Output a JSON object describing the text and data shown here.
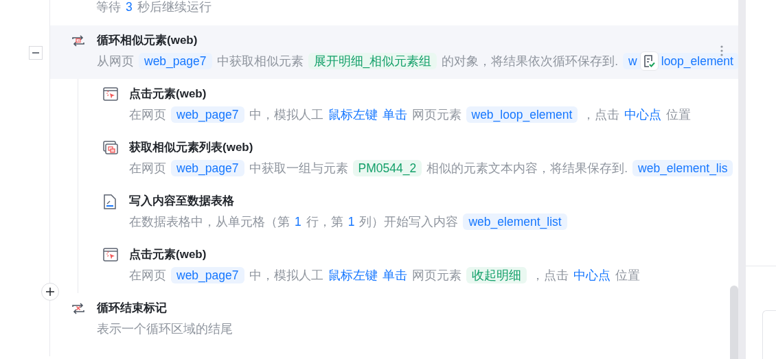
{
  "steps": [
    {
      "kind": "partial",
      "description": [
        {
          "kind": "text",
          "text": "等待"
        },
        {
          "kind": "param",
          "text": "3"
        },
        {
          "kind": "text",
          "text": "秒后继续运行"
        }
      ]
    },
    {
      "kind": "loop",
      "selected": true,
      "expanded": true,
      "title": "循环相似元素(web)",
      "description": [
        {
          "kind": "text",
          "text": "从网页"
        },
        {
          "kind": "var",
          "text": "web_page7"
        },
        {
          "kind": "text",
          "text": "中获取相似元素"
        },
        {
          "kind": "elem",
          "text": "展开明细_相似元素组"
        },
        {
          "kind": "text",
          "text": "的对象，将结果依次循环保存到."
        },
        {
          "kind": "var-split",
          "parts": [
            "w",
            "loop_element"
          ]
        }
      ],
      "children": [
        {
          "kind": "click",
          "selected": false,
          "title": "点击元素(web)",
          "description": [
            {
              "kind": "text",
              "text": "在网页"
            },
            {
              "kind": "var",
              "text": "web_page7"
            },
            {
              "kind": "text",
              "text": "中，模拟人工"
            },
            {
              "kind": "param",
              "text": "鼠标左键"
            },
            {
              "kind": "param",
              "text": "单击"
            },
            {
              "kind": "text",
              "text": "网页元素"
            },
            {
              "kind": "var",
              "text": "web_loop_element"
            },
            {
              "kind": "text",
              "text": "，点击"
            },
            {
              "kind": "param",
              "text": "中心点"
            },
            {
              "kind": "text",
              "text": "位置"
            }
          ]
        },
        {
          "kind": "list",
          "selected": false,
          "title": "获取相似元素列表(web)",
          "description": [
            {
              "kind": "text",
              "text": "在网页"
            },
            {
              "kind": "var",
              "text": "web_page7"
            },
            {
              "kind": "text",
              "text": "中获取一组与元素"
            },
            {
              "kind": "elem",
              "text": "PM0544_2"
            },
            {
              "kind": "text",
              "text": "相似的元素文本内容，将结果保存到."
            },
            {
              "kind": "var",
              "text": "web_element_lis"
            }
          ]
        },
        {
          "kind": "write",
          "selected": false,
          "title": "写入内容至数据表格",
          "description": [
            {
              "kind": "text",
              "text": "在数据表格中，从单元格（第"
            },
            {
              "kind": "param",
              "text": "1"
            },
            {
              "kind": "text",
              "text": "行，第"
            },
            {
              "kind": "param",
              "text": "1"
            },
            {
              "kind": "text",
              "text": "列）开始写入内容"
            },
            {
              "kind": "var",
              "text": "web_element_list"
            }
          ]
        },
        {
          "kind": "click",
          "selected": false,
          "title": "点击元素(web)",
          "description": [
            {
              "kind": "text",
              "text": "在网页"
            },
            {
              "kind": "var",
              "text": "web_page7"
            },
            {
              "kind": "text",
              "text": "中，模拟人工"
            },
            {
              "kind": "param",
              "text": "鼠标左键"
            },
            {
              "kind": "param",
              "text": "单击"
            },
            {
              "kind": "text",
              "text": "网页元素"
            },
            {
              "kind": "elem",
              "text": "收起明细"
            },
            {
              "kind": "text",
              "text": "，点击"
            },
            {
              "kind": "param",
              "text": "中心点"
            },
            {
              "kind": "text",
              "text": "位置"
            }
          ]
        }
      ]
    },
    {
      "kind": "loopend",
      "selected": false,
      "title": "循环结束标记",
      "description": [
        {
          "kind": "text",
          "text": "表示一个循环区域的结尾"
        }
      ]
    }
  ]
}
